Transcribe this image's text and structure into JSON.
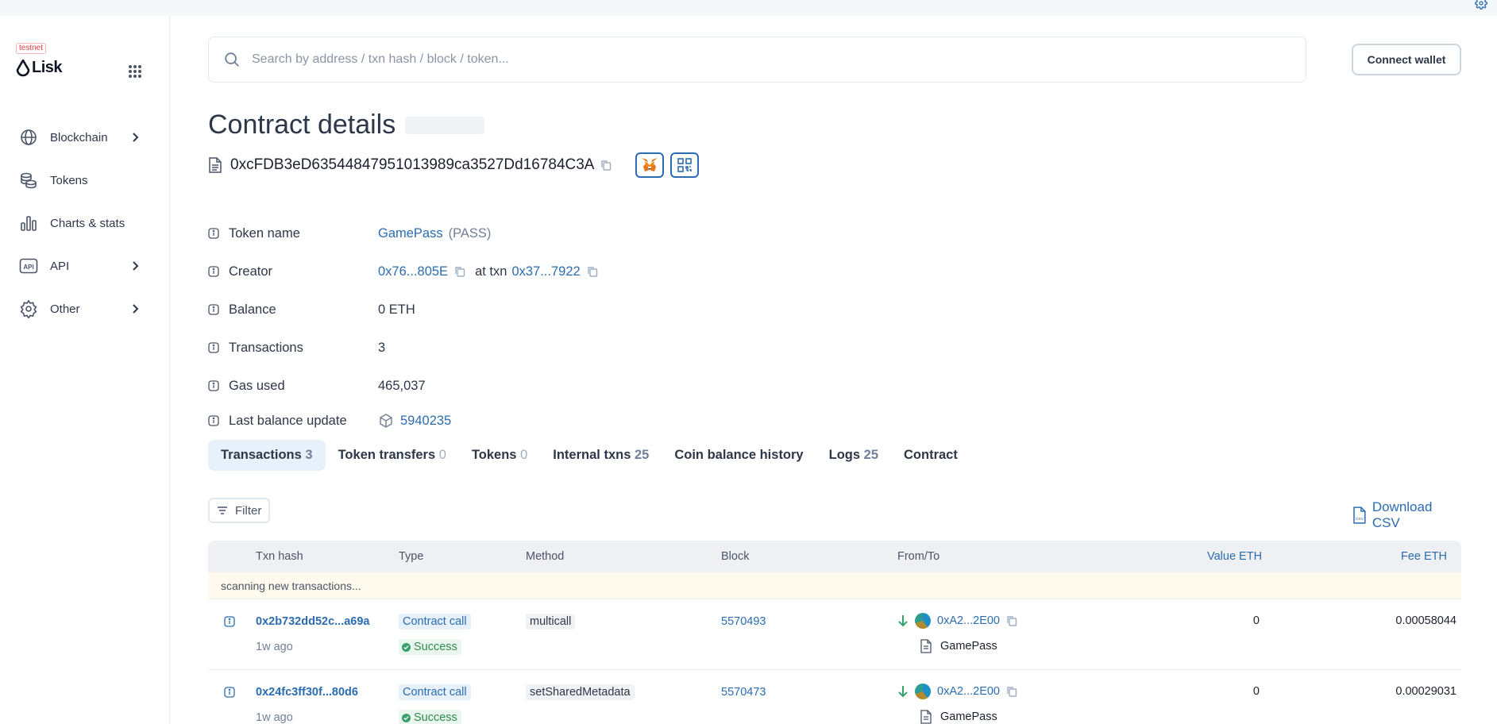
{
  "sidebar": {
    "testnet_badge": "testnet",
    "logo_text": "Lisk",
    "items": [
      {
        "label": "Blockchain",
        "icon": "globe-icon",
        "has_chevron": true
      },
      {
        "label": "Tokens",
        "icon": "coins-icon",
        "has_chevron": false
      },
      {
        "label": "Charts & stats",
        "icon": "chart-icon",
        "has_chevron": false
      },
      {
        "label": "API",
        "icon": "api-icon",
        "has_chevron": true
      },
      {
        "label": "Other",
        "icon": "gear-icon",
        "has_chevron": true
      }
    ]
  },
  "header": {
    "search_placeholder": "Search by address / txn hash / block / token...",
    "connect_wallet": "Connect wallet"
  },
  "page": {
    "title": "Contract details",
    "address": "0xcFDB3eD63544847951013989ca3527Dd16784C3A"
  },
  "details": {
    "token_name": {
      "label": "Token name",
      "name": "GamePass",
      "symbol": "(PASS)"
    },
    "creator": {
      "label": "Creator",
      "address": "0x76...805E",
      "at_txn": "at txn",
      "txn": "0x37...7922"
    },
    "balance": {
      "label": "Balance",
      "value": "0 ETH"
    },
    "transactions": {
      "label": "Transactions",
      "value": "3"
    },
    "gas_used": {
      "label": "Gas used",
      "value": "465,037"
    },
    "last_balance_update": {
      "label": "Last balance update",
      "value": "5940235"
    }
  },
  "tabs": [
    {
      "label": "Transactions",
      "count": "3"
    },
    {
      "label": "Token transfers",
      "count": "0"
    },
    {
      "label": "Tokens",
      "count": "0"
    },
    {
      "label": "Internal txns",
      "count": "25"
    },
    {
      "label": "Coin balance history",
      "count": ""
    },
    {
      "label": "Logs",
      "count": "25"
    },
    {
      "label": "Contract",
      "count": ""
    }
  ],
  "toolbar": {
    "filter": "Filter",
    "download": "Download CSV"
  },
  "table": {
    "headers": {
      "txn_hash": "Txn hash",
      "type": "Type",
      "method": "Method",
      "block": "Block",
      "from_to": "From/To",
      "value": "Value ETH",
      "fee": "Fee ETH"
    },
    "scanning": "scanning new transactions...",
    "rows": [
      {
        "hash": "0x2b732dd52c...a69a",
        "age": "1w ago",
        "type": "Contract call",
        "status": "Success",
        "method": "multicall",
        "block": "5570493",
        "from": "0xA2...2E00",
        "to": "GamePass",
        "value": "0",
        "fee": "0.00058044"
      },
      {
        "hash": "0x24fc3ff30f...80d6",
        "age": "1w ago",
        "type": "Contract call",
        "status": "Success",
        "method": "setSharedMetadata",
        "block": "5570473",
        "from": "0xA2...2E00",
        "to": "GamePass",
        "value": "0",
        "fee": "0.00029031"
      }
    ]
  },
  "colors": {
    "link": "#2b6cb0",
    "active_tab_bg": "#e6f1fb",
    "success": "#38a169",
    "scanning_bg": "#fffaed"
  }
}
